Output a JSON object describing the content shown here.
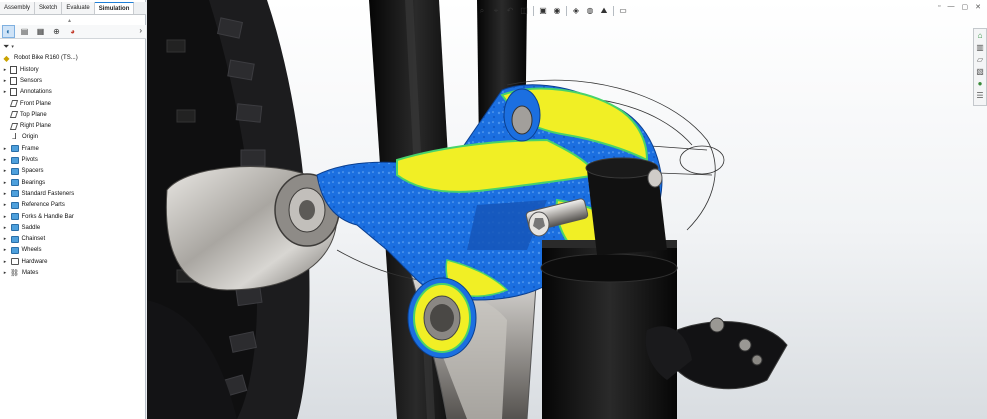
{
  "command_manager": {
    "tabs": [
      "Assembly",
      "Sketch",
      "Evaluate",
      "Simulation"
    ],
    "active_tab": "Simulation",
    "grip": "▴"
  },
  "panel_icons": [
    {
      "name": "feature-manager-icon",
      "glyph": "◐",
      "color": "#2a6fa8"
    },
    {
      "name": "property-manager-icon",
      "glyph": "▤",
      "color": "#3a3a3a"
    },
    {
      "name": "configuration-manager-icon",
      "glyph": "▦",
      "color": "#3a3a3a"
    },
    {
      "name": "dimxpert-manager-icon",
      "glyph": "⊕",
      "color": "#3a3a3a"
    },
    {
      "name": "display-manager-icon",
      "glyph": "◕",
      "color": "#c23a2a"
    }
  ],
  "panel_arrow": "›",
  "filter": {
    "icon": "filter-icon",
    "glyph": "⏷",
    "chevron": "▾"
  },
  "tree": {
    "root": "Robot Bike R160  (TS...)",
    "items": [
      {
        "label": "History",
        "expand": "▸",
        "icon": "doc"
      },
      {
        "label": "Sensors",
        "expand": "▸",
        "icon": "doc"
      },
      {
        "label": "Annotations",
        "expand": "▸",
        "icon": "doc"
      },
      {
        "label": "Front Plane",
        "expand": "",
        "icon": "plane"
      },
      {
        "label": "Top Plane",
        "expand": "",
        "icon": "plane"
      },
      {
        "label": "Right Plane",
        "expand": "",
        "icon": "plane"
      },
      {
        "label": "Origin",
        "expand": "",
        "icon": "origin"
      },
      {
        "label": "Frame",
        "expand": "▸",
        "icon": "folder"
      },
      {
        "label": "Pivots",
        "expand": "▸",
        "icon": "folder"
      },
      {
        "label": "Spacers",
        "expand": "▸",
        "icon": "folder"
      },
      {
        "label": "Bearings",
        "expand": "▸",
        "icon": "folder"
      },
      {
        "label": "Standard Fasteners",
        "expand": "▸",
        "icon": "folder"
      },
      {
        "label": "Reference Parts",
        "expand": "▸",
        "icon": "folder"
      },
      {
        "label": "Forks  & Handle Bar",
        "expand": "▸",
        "icon": "folder"
      },
      {
        "label": "Saddle",
        "expand": "▸",
        "icon": "folder"
      },
      {
        "label": "Chainset",
        "expand": "▸",
        "icon": "folder"
      },
      {
        "label": "Wheels",
        "expand": "▸",
        "icon": "folder"
      },
      {
        "label": "Hardware",
        "expand": "▸",
        "icon": "folder-empty"
      },
      {
        "label": "Mates",
        "expand": "▸",
        "icon": "mates"
      }
    ]
  },
  "heads_up_toolbar": [
    {
      "name": "zoom-to-fit-icon",
      "glyph": "⌕"
    },
    {
      "name": "zoom-to-area-icon",
      "glyph": "⌖"
    },
    {
      "name": "previous-view-icon",
      "glyph": "↶"
    },
    {
      "name": "section-view-icon",
      "glyph": "◫"
    },
    {
      "name": "view-orientation-icon",
      "glyph": "▣"
    },
    {
      "name": "display-style-icon",
      "glyph": "◉"
    },
    {
      "name": "hide-show-items-icon",
      "glyph": "◈"
    },
    {
      "name": "edit-appearance-icon",
      "glyph": "◍"
    },
    {
      "name": "apply-scene-icon",
      "glyph": "⛰"
    },
    {
      "name": "view-settings-icon",
      "glyph": "▭"
    }
  ],
  "window_controls": [
    {
      "name": "restore-window-icon",
      "glyph": "▫"
    },
    {
      "name": "minimize-window-icon",
      "glyph": "—"
    },
    {
      "name": "maximize-window-icon",
      "glyph": "▢"
    },
    {
      "name": "close-window-icon",
      "glyph": "✕"
    }
  ],
  "task_pane": [
    {
      "name": "solidworks-resources-icon",
      "glyph": "⌂",
      "color": "#2a8a3a"
    },
    {
      "name": "design-library-icon",
      "glyph": "▥",
      "color": "#555555"
    },
    {
      "name": "file-explorer-icon",
      "glyph": "▱",
      "color": "#555555"
    },
    {
      "name": "view-palette-icon",
      "glyph": "▧",
      "color": "#555555"
    },
    {
      "name": "appearances-icon",
      "glyph": "●",
      "color": "#3a8a3a"
    },
    {
      "name": "custom-properties-icon",
      "glyph": "☰",
      "color": "#555555"
    }
  ],
  "colors": {
    "stress_blue": "#1b6fe0",
    "stress_yellow": "#f1ef25",
    "stress_green": "#48d36a",
    "fork_black": "#121212",
    "metal": "#b8b6b2",
    "accent": "#1e7fd8"
  }
}
